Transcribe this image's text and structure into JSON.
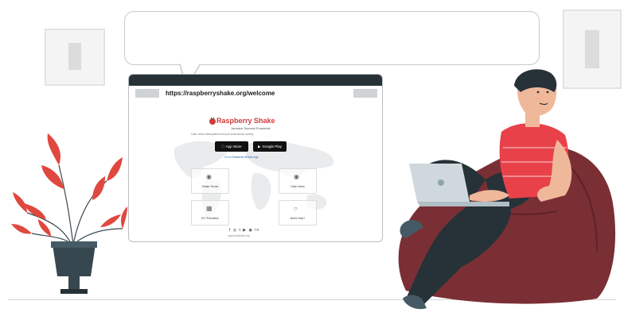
{
  "browser": {
    "url": "https://raspberryshake.org/welcome"
  },
  "page": {
    "brand_name": "Raspberry Shake",
    "brand_subtitle": "Jamaica Tsunami Ensemble",
    "tagline": "Learn about earthquakes and your local seismic activity",
    "app_store_label": "App Store",
    "google_play_label": "Google Play",
    "cta_link": "Go to Shakenet Mobile App",
    "cards": [
      {
        "label": "Shake Sense",
        "icon": "pin-icon"
      },
      {
        "label": "Data Views",
        "icon": "pin-icon"
      },
      {
        "label": "DIY Education",
        "icon": "book-icon"
      },
      {
        "label": "Need Help?",
        "icon": "help-icon"
      }
    ],
    "social_icons": "f ◎ t ▶ ◉ in",
    "site_url": "raspberryshake.org"
  },
  "colors": {
    "shirt": "#e8414a",
    "beanbag": "#7a2f35",
    "plant_leaf": "#e0483f",
    "pot": "#37474f",
    "titlebar": "#263238"
  }
}
